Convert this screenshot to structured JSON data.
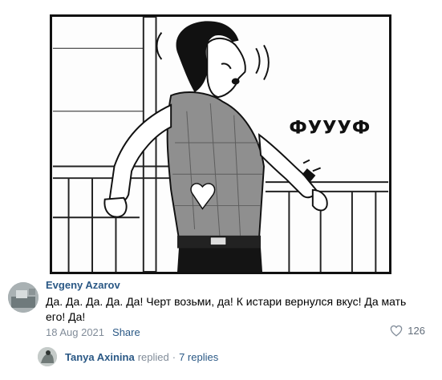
{
  "panel": {
    "sfx": "ФУУУФ"
  },
  "comment": {
    "author": "Evgeny Azarov",
    "text": "Да. Да. Да. Да. Да! Черт возьми, да! К истари вернулся вкус! Да мать его! Да!",
    "date": "18 Aug 2021",
    "share_label": "Share",
    "likes": "126"
  },
  "replies": {
    "name": "Tanya Axinina",
    "action": "replied",
    "separator": "·",
    "count_label": "7 replies"
  },
  "colors": {
    "link": "#2a5885",
    "muted": "#818c99"
  }
}
